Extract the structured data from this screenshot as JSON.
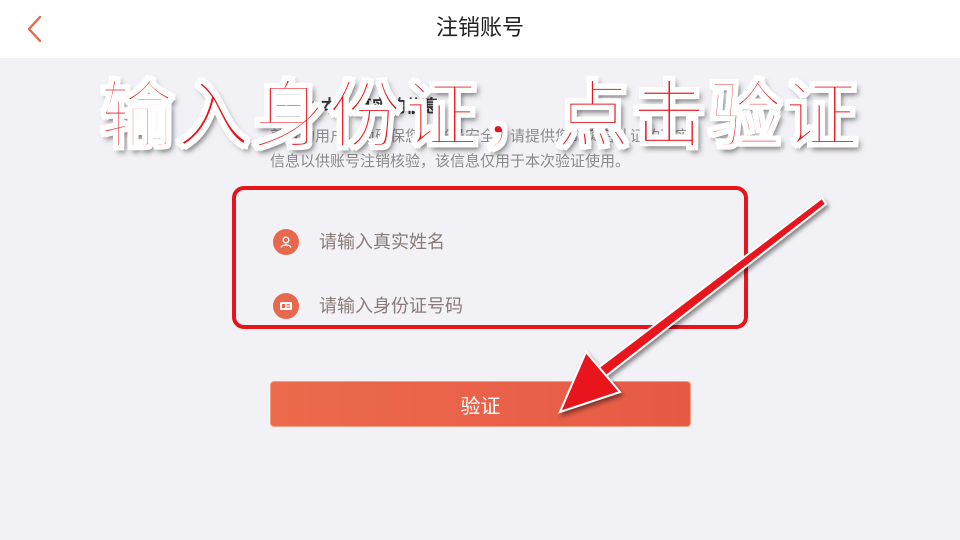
{
  "header": {
    "title": "注销账号",
    "back_icon": "chevron-left-icon"
  },
  "section": {
    "title": "请输入本人真实的信息",
    "description": "尊敬的用户，为确保您的账号安全，请提供您的实名认证的真实信息以供账号注销核验，该信息仅用于本次验证使用。"
  },
  "form": {
    "name_placeholder": "请输入真实姓名",
    "name_icon": "user-icon",
    "id_placeholder": "请输入身份证号码",
    "id_icon": "id-card-icon",
    "verify_label": "验证"
  },
  "annotation": {
    "caption": "输入身份证，点击验证"
  },
  "colors": {
    "accent": "#e65a45",
    "annotation": "#e8141c"
  }
}
